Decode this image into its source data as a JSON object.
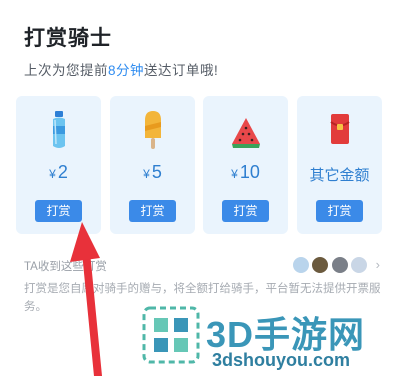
{
  "header": {
    "title": "打赏骑士",
    "subtitle_prefix": "上次为您提前",
    "subtitle_highlight": "8分钟",
    "subtitle_suffix": "送达订单哦!"
  },
  "tips": [
    {
      "amount": "2",
      "currency": "¥",
      "button": "打赏",
      "icon": "water-bottle-icon"
    },
    {
      "amount": "5",
      "currency": "¥",
      "button": "打赏",
      "icon": "popsicle-icon"
    },
    {
      "amount": "10",
      "currency": "¥",
      "button": "打赏",
      "icon": "watermelon-icon"
    },
    {
      "amount": "其它金额",
      "currency": "",
      "button": "打赏",
      "icon": "red-envelope-icon"
    }
  ],
  "received": {
    "label": "TA收到这些打赏"
  },
  "description": "打赏是您自愿对骑手的赠与，将全额打给骑手，平台暂无法提供开票服务。",
  "watermark": {
    "brand": "3D手游网",
    "domain": "3dshouyou.com"
  },
  "colors": {
    "accent": "#3b8ae8",
    "card_bg": "#eaf4fd",
    "highlight": "#2f8cf0",
    "arrow": "#e8313a"
  }
}
